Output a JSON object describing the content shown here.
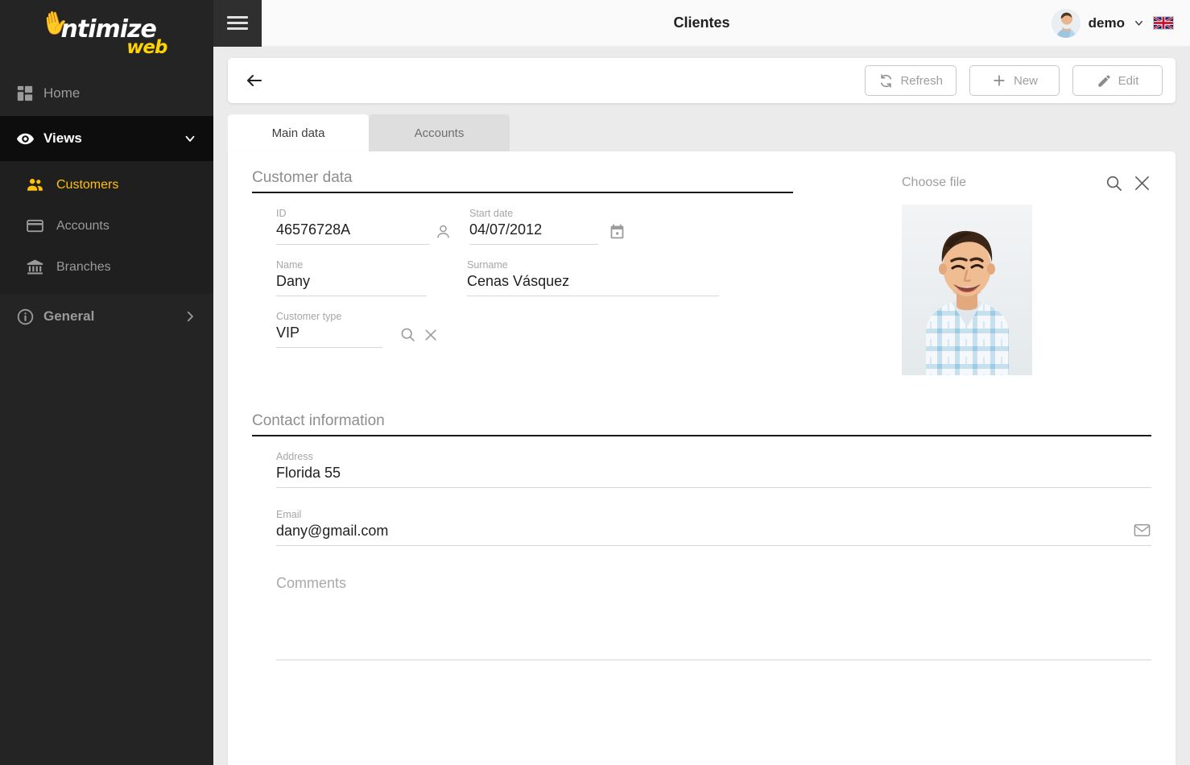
{
  "sidebar": {
    "logo": {
      "main": "ntimize",
      "sub": "web",
      "hand_icon": "ok-hand-icon"
    },
    "items": [
      {
        "label": "Home",
        "icon": "dashboard-icon",
        "state": "normal"
      },
      {
        "label": "Views",
        "icon": "eye-icon",
        "state": "expanded",
        "chevron": "chevron-down-icon"
      }
    ],
    "submenu": [
      {
        "label": "Customers",
        "icon": "people-icon",
        "active": true
      },
      {
        "label": "Accounts",
        "icon": "credit-card-icon",
        "active": false
      },
      {
        "label": "Branches",
        "icon": "bank-icon",
        "active": false
      }
    ],
    "general": {
      "label": "General",
      "icon": "info-icon",
      "chevron": "chevron-right-icon"
    },
    "colors": {
      "background": "#242424",
      "active_row": "#0d0d0d",
      "submenu_bg": "#1f1f1f",
      "accent": "#ffc107",
      "muted_text": "#9a9a9a"
    }
  },
  "topbar": {
    "menu_icon": "hamburger-icon",
    "title": "Clientes",
    "user": "demo",
    "user_chevron": "chevron-down-icon",
    "avatar": "user-avatar",
    "language_flag": "uk-flag-icon"
  },
  "toolbar": {
    "back_icon": "arrow-left-icon",
    "refresh_label": "Refresh",
    "new_label": "New",
    "edit_label": "Edit"
  },
  "tabs": [
    {
      "label": "Main data",
      "active": true
    },
    {
      "label": "Accounts",
      "active": false
    }
  ],
  "customer_data": {
    "section_title": "Customer data",
    "fields": [
      {
        "label": "ID",
        "value": "46576728A",
        "icon": "person-icon"
      },
      {
        "label": "Start date",
        "value": "04/07/2012",
        "icon": "calendar-icon"
      },
      {
        "label": "Name",
        "value": "Dany",
        "icon": ""
      },
      {
        "label": "Surname",
        "value": "Cenas Vásquez",
        "icon": ""
      },
      {
        "label": "Customer type",
        "value": "VIP",
        "icon": "search-icon,close-icon"
      }
    ]
  },
  "file_picker": {
    "label": "Choose file",
    "search_icon": "search-icon",
    "clear_icon": "close-icon",
    "photo_alt": "customer-photo"
  },
  "contact_information": {
    "section_title": "Contact information",
    "fields": [
      {
        "label": "Address",
        "value": "Florida 55",
        "icon": ""
      },
      {
        "label": "Email",
        "value": "dany@gmail.com",
        "icon": "email-icon"
      }
    ],
    "comments_label": "Comments",
    "comments_value": ""
  },
  "theme": {
    "page_bg": "#ebebeb",
    "card_bg": "#ffffff",
    "text_primary": "#1f1f1f",
    "text_muted": "#a6a6a6",
    "rule_dark": "#1a1a1a",
    "rule_light": "#d6d6d6"
  }
}
